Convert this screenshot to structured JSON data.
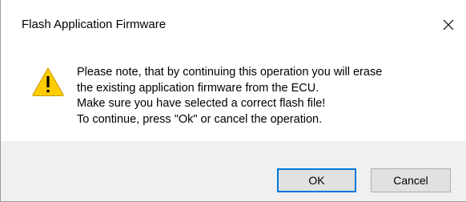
{
  "dialog": {
    "title": "Flash Application Firmware",
    "close_icon": "close-icon",
    "warning_icon": "warning-triangle-icon",
    "message_lines": [
      "Please note, that by continuing this operation you will erase",
      "the existing application firmware from the ECU.",
      "Make sure you have selected a correct flash file!",
      "To continue, press \"Ok\" or cancel the operation."
    ],
    "buttons": {
      "ok_label": "OK",
      "cancel_label": "Cancel"
    }
  },
  "colors": {
    "accent": "#0078d7",
    "footer_bg": "#f0f0f0",
    "button_bg": "#e1e1e1",
    "warning_fill": "#ffcc00"
  }
}
